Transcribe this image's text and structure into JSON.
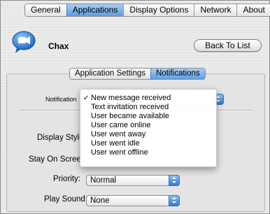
{
  "tabs": {
    "items": [
      "General",
      "Applications",
      "Display Options",
      "Network",
      "About"
    ],
    "active_index": 1
  },
  "app": {
    "name": "Chax",
    "icon": "chat-bubble-camera-icon"
  },
  "back_button": {
    "label": "Back To List"
  },
  "sub_tabs": {
    "items": [
      "Application Settings",
      "Notifications"
    ],
    "active_index": 1
  },
  "fields": {
    "notification_label": "Notification",
    "display_style_label": "Display Style",
    "stay_on_screen_label": "Stay On Screen",
    "priority_label": "Priority:",
    "priority_value": "Normal",
    "play_sound_label": "Play Sound:",
    "play_sound_value": "None"
  },
  "notification_menu": {
    "items": [
      "New message received",
      "Text invitation received",
      "User became available",
      "User came online",
      "User went away",
      "User went idle",
      "User went offline"
    ],
    "checked_index": 0,
    "check_glyph": "✓"
  },
  "colors": {
    "selected_blue": "#5d9de3",
    "window_bg": "#ececec"
  }
}
